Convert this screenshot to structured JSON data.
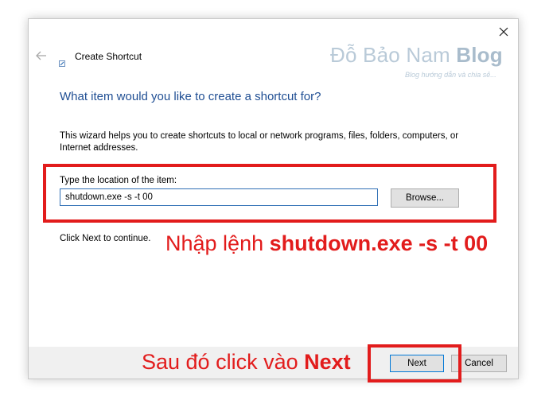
{
  "window": {
    "title": "Create Shortcut",
    "close_symbol": "✕"
  },
  "watermark": {
    "brand_light": "Đỗ Bảo Nam ",
    "brand_bold": "Blog",
    "tagline": "Blog hướng dẫn và chia sẻ..."
  },
  "wizard": {
    "heading": "What item would you like to create a shortcut for?",
    "description": "This wizard helps you to create shortcuts to local or network programs, files, folders, computers, or Internet addresses.",
    "location_label": "Type the location of the item:",
    "location_value": "shutdown.exe -s -t 00",
    "browse_label": "Browse...",
    "continue_text": "Click Next to continue."
  },
  "footer": {
    "next_label": "Next",
    "cancel_label": "Cancel"
  },
  "annotations": {
    "command_prefix": "Nhập lệnh ",
    "command_bold": "shutdown.exe -s -t 00",
    "next_prefix": "Sau đó click vào ",
    "next_bold": "Next"
  },
  "colors": {
    "heading_blue": "#1f4e93",
    "annotation_red": "#e21c1c",
    "input_border": "#2f6fb5",
    "footer_bg": "#f0f0f0"
  },
  "icons": [
    "close-icon",
    "back-arrow-icon",
    "shortcut-app-icon"
  ]
}
